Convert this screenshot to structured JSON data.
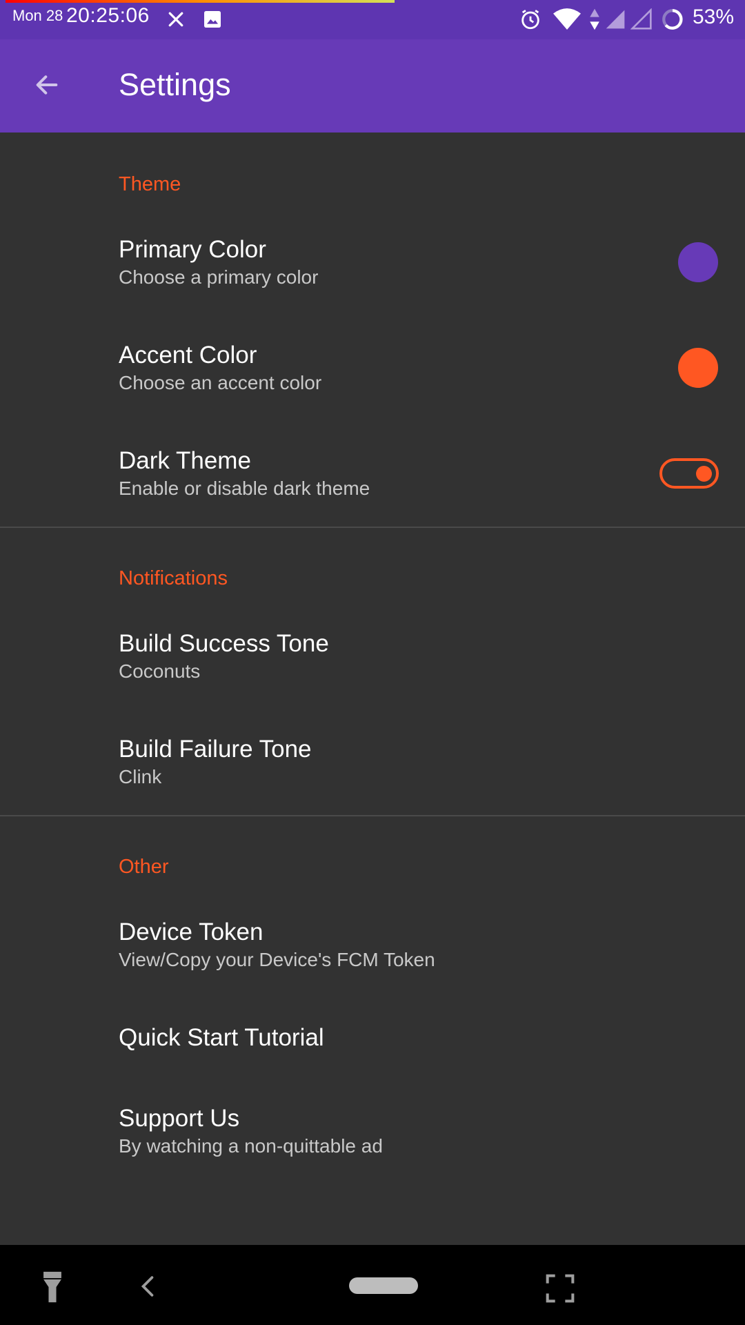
{
  "status_bar": {
    "date": "Mon 28",
    "time": "20:25:06",
    "battery": "53%",
    "icons": [
      "close-icon",
      "image-icon",
      "alarm-icon",
      "wifi-icon",
      "data-arrows-icon",
      "signal-icon",
      "signal-empty-icon",
      "battery-circle-icon"
    ]
  },
  "app_bar": {
    "title": "Settings",
    "back_icon": "arrow-back-icon",
    "color": "#673ab7"
  },
  "sections": {
    "theme": {
      "header": "Theme",
      "primary_color": {
        "title": "Primary Color",
        "summary": "Choose a primary color",
        "value": "#673ab7"
      },
      "accent_color": {
        "title": "Accent Color",
        "summary": "Choose an accent color",
        "value": "#ff5722"
      },
      "dark_theme": {
        "title": "Dark Theme",
        "summary": "Enable or disable dark theme",
        "enabled": true
      }
    },
    "notifications": {
      "header": "Notifications",
      "success_tone": {
        "title": "Build Success Tone",
        "summary": "Coconuts"
      },
      "failure_tone": {
        "title": "Build Failure Tone",
        "summary": "Clink"
      }
    },
    "other": {
      "header": "Other",
      "device_token": {
        "title": "Device Token",
        "summary": "View/Copy your Device's FCM Token"
      },
      "quick_start": {
        "title": "Quick Start Tutorial"
      },
      "support_us": {
        "title": "Support Us",
        "summary": "By watching a non-quittable ad"
      }
    }
  },
  "nav_bar": {
    "icons": [
      "flashlight-icon",
      "nav-back-icon",
      "home-pill",
      "screenshot-icon"
    ]
  },
  "colors": {
    "background": "#323232",
    "accent": "#ff5722",
    "status_bar": "#5e35b1"
  }
}
